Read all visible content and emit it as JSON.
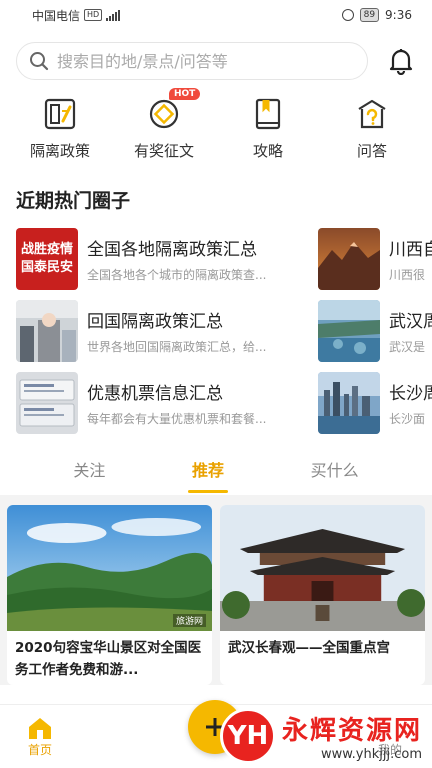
{
  "status_bar": {
    "carrier": "中国电信",
    "hd": "HD",
    "battery": "89",
    "time": "9:36"
  },
  "search": {
    "placeholder": "搜索目的地/景点/问答等"
  },
  "categories": [
    {
      "label": "隔离政策",
      "icon": "policy-icon"
    },
    {
      "label": "有奖征文",
      "icon": "coin-icon",
      "badge": "HOT"
    },
    {
      "label": "攻略",
      "icon": "bookmark-book-icon"
    },
    {
      "label": "问答",
      "icon": "question-icon"
    }
  ],
  "section_title": "近期热门圈子",
  "circles_left": [
    {
      "title": "全国各地隔离政策汇总",
      "desc": "全国各地各个城市的隔离政策查...",
      "thumb_text": [
        "战胜疫情",
        "国泰民安"
      ]
    },
    {
      "title": "回国隔离政策汇总",
      "desc": "世界各地回国隔离政策汇总，给..."
    },
    {
      "title": "优惠机票信息汇总",
      "desc": "每年都会有大量优惠机票和套餐..."
    }
  ],
  "circles_right": [
    {
      "title": "川西自",
      "desc": "川西很"
    },
    {
      "title": "武汉周",
      "desc": "武汉是"
    },
    {
      "title": "长沙周",
      "desc": "长沙面"
    }
  ],
  "tabs": [
    {
      "label": "关注",
      "active": false
    },
    {
      "label": "推荐",
      "active": true
    },
    {
      "label": "买什么",
      "active": false
    }
  ],
  "feed": [
    {
      "title": "2020句容宝华山景区对全国医务工作者免费和游...",
      "img_tag": "旅游网"
    },
    {
      "title": "武汉长春观——全国重点宫"
    }
  ],
  "bottom_nav": {
    "home": "首页",
    "mine": "我的"
  },
  "watermark": {
    "logo_text": "YH",
    "cn": "永辉资源网",
    "url": "www.yhkjjj.com"
  },
  "colors": {
    "accent": "#f5b800",
    "hot": "#f04a3c",
    "watermark": "#e8231f"
  }
}
